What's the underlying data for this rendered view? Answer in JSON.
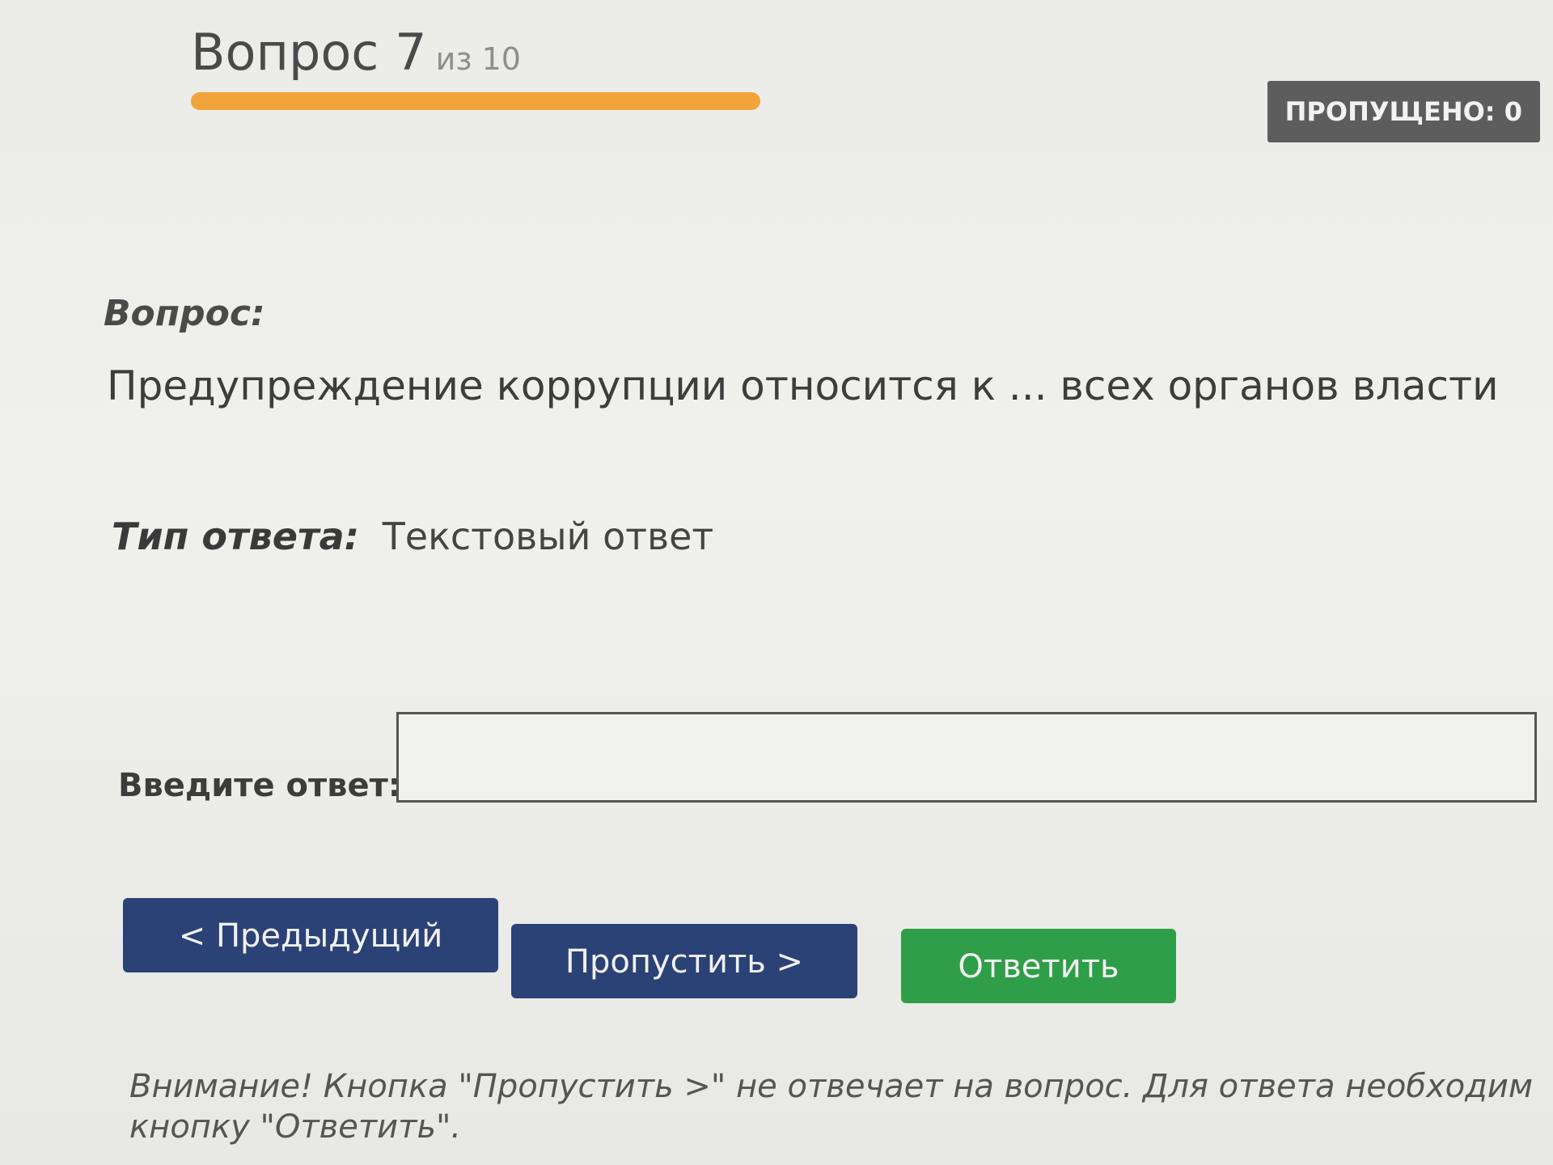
{
  "header": {
    "question_label": "Вопрос 7",
    "question_of": "из 10",
    "progress_fraction": 0.7,
    "skipped_badge": "ПРОПУЩЕНО: 0"
  },
  "question": {
    "label": "Вопрос:",
    "text": "Предупреждение коррупции относится к ... всех органов власти"
  },
  "answer_type": {
    "label": "Тип ответа:",
    "value": "Текстовый ответ"
  },
  "answer_input": {
    "label": "Введите ответ:",
    "value": ""
  },
  "buttons": {
    "previous": "< Предыдущий",
    "skip": "Пропустить >",
    "answer": "Ответить"
  },
  "warning": "Внимание! Кнопка \"Пропустить >\" не отвечает на вопрос. Для ответа необходим кнопку \"Ответить\".",
  "colors": {
    "progress": "#f0a43a",
    "primary_button": "#2b4276",
    "answer_button": "#2f9e49",
    "badge": "#5d5d5d"
  }
}
